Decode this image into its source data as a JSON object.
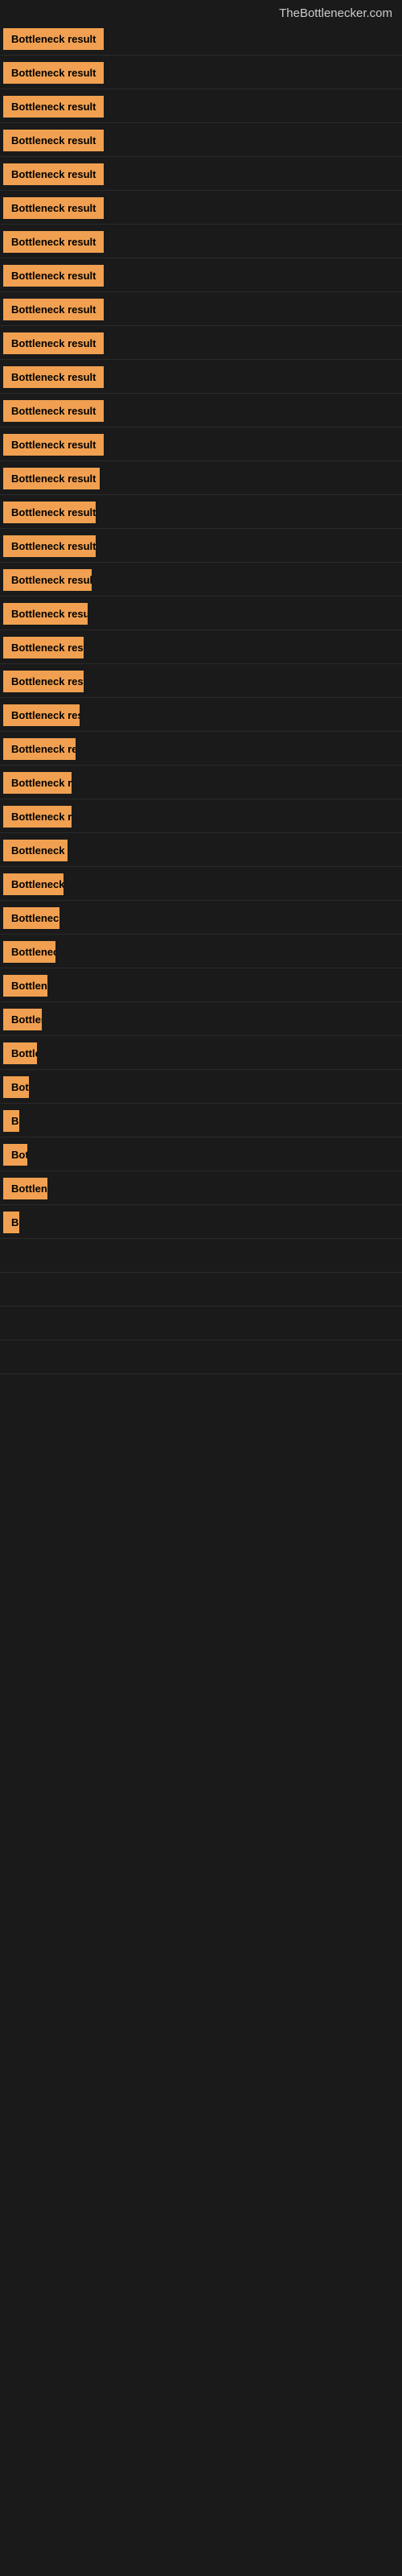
{
  "header": {
    "title": "TheBottlenecker.com"
  },
  "rows": [
    {
      "id": 1,
      "label": "Bottleneck result",
      "width": 145
    },
    {
      "id": 2,
      "label": "Bottleneck result",
      "width": 145
    },
    {
      "id": 3,
      "label": "Bottleneck result",
      "width": 145
    },
    {
      "id": 4,
      "label": "Bottleneck result",
      "width": 145
    },
    {
      "id": 5,
      "label": "Bottleneck result",
      "width": 145
    },
    {
      "id": 6,
      "label": "Bottleneck result",
      "width": 135
    },
    {
      "id": 7,
      "label": "Bottleneck result",
      "width": 135
    },
    {
      "id": 8,
      "label": "Bottleneck result",
      "width": 135
    },
    {
      "id": 9,
      "label": "Bottleneck result",
      "width": 135
    },
    {
      "id": 10,
      "label": "Bottleneck result",
      "width": 130
    },
    {
      "id": 11,
      "label": "Bottleneck result",
      "width": 130
    },
    {
      "id": 12,
      "label": "Bottleneck result",
      "width": 125
    },
    {
      "id": 13,
      "label": "Bottleneck result",
      "width": 125
    },
    {
      "id": 14,
      "label": "Bottleneck result",
      "width": 120
    },
    {
      "id": 15,
      "label": "Bottleneck result",
      "width": 115
    },
    {
      "id": 16,
      "label": "Bottleneck result",
      "width": 115
    },
    {
      "id": 17,
      "label": "Bottleneck result",
      "width": 110
    },
    {
      "id": 18,
      "label": "Bottleneck result",
      "width": 105
    },
    {
      "id": 19,
      "label": "Bottleneck result",
      "width": 100
    },
    {
      "id": 20,
      "label": "Bottleneck result",
      "width": 100
    },
    {
      "id": 21,
      "label": "Bottleneck result",
      "width": 95
    },
    {
      "id": 22,
      "label": "Bottleneck result",
      "width": 90
    },
    {
      "id": 23,
      "label": "Bottleneck result",
      "width": 85
    },
    {
      "id": 24,
      "label": "Bottleneck result",
      "width": 85
    },
    {
      "id": 25,
      "label": "Bottleneck result",
      "width": 80
    },
    {
      "id": 26,
      "label": "Bottleneck result",
      "width": 75
    },
    {
      "id": 27,
      "label": "Bottleneck result",
      "width": 70
    },
    {
      "id": 28,
      "label": "Bottleneck result",
      "width": 65
    },
    {
      "id": 29,
      "label": "Bottleneck result",
      "width": 55
    },
    {
      "id": 30,
      "label": "Bottleneck result",
      "width": 48
    },
    {
      "id": 31,
      "label": "Bottleneck result",
      "width": 42
    },
    {
      "id": 32,
      "label": "Bottleneck result",
      "width": 32
    },
    {
      "id": 33,
      "label": "Bottleneck result",
      "width": 14
    },
    {
      "id": 34,
      "label": "Bottleneck result",
      "width": 30
    },
    {
      "id": 35,
      "label": "Bottleneck result",
      "width": 55
    },
    {
      "id": 36,
      "label": "Bottleneck result",
      "width": 12
    },
    {
      "id": 37,
      "label": "",
      "width": 0
    },
    {
      "id": 38,
      "label": "",
      "width": 0
    },
    {
      "id": 39,
      "label": "",
      "width": 0
    },
    {
      "id": 40,
      "label": "",
      "width": 0
    }
  ]
}
